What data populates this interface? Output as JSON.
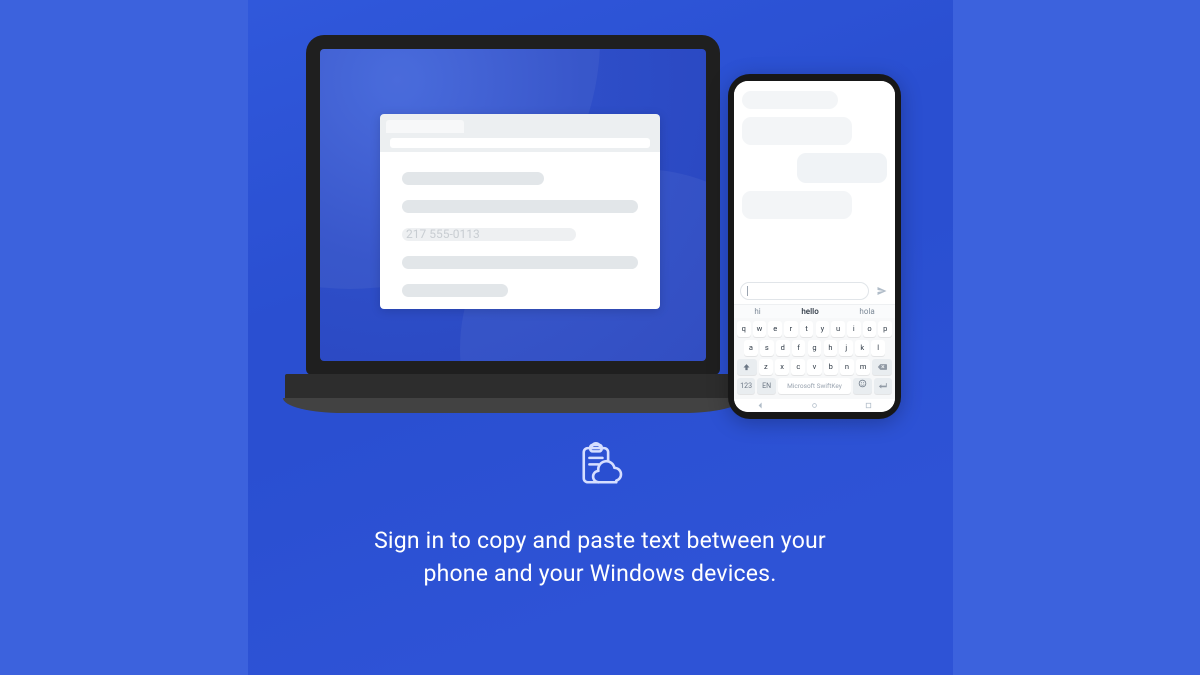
{
  "laptop": {
    "browser": {
      "sample_text": "217 555-0113"
    }
  },
  "phone": {
    "suggestions": {
      "s1": "hi",
      "s2": "hello",
      "s3": "hola"
    },
    "keyboard": {
      "row1": [
        "q",
        "w",
        "e",
        "r",
        "t",
        "y",
        "u",
        "i",
        "o",
        "p"
      ],
      "row2": [
        "a",
        "s",
        "d",
        "f",
        "g",
        "h",
        "j",
        "k",
        "l"
      ],
      "row3": [
        "z",
        "x",
        "c",
        "v",
        "b",
        "n",
        "m"
      ],
      "num_key": "123",
      "lang_key": "EN",
      "space_label": "Microsoft SwiftKey"
    }
  },
  "feature": {
    "icon_name": "clipboard-cloud-icon",
    "caption": "Sign in to copy and paste text between your phone and your Windows devices."
  }
}
